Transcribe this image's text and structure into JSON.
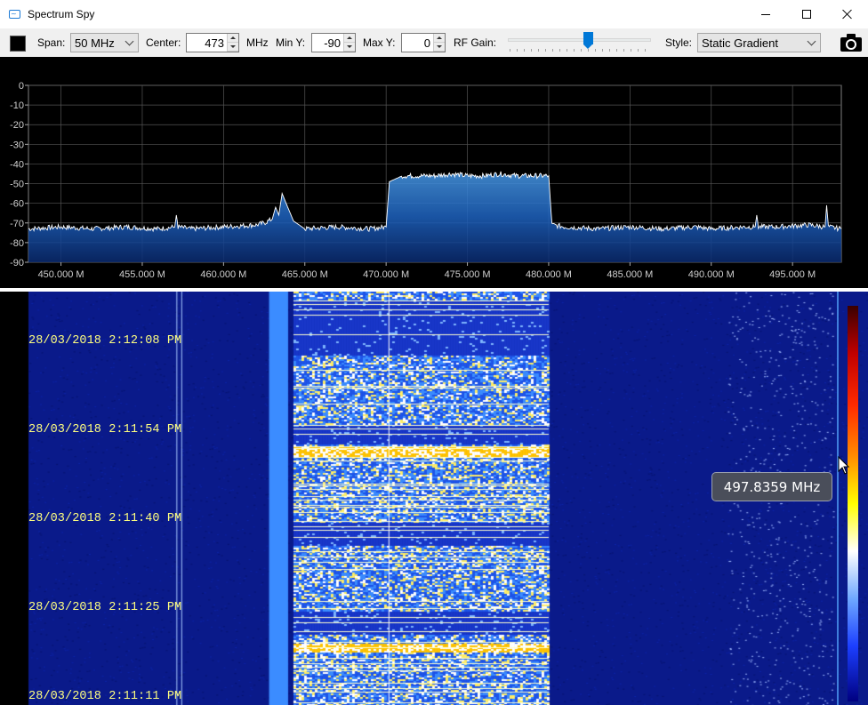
{
  "window": {
    "title": "Spectrum Spy",
    "icon": "spectrum-app-icon"
  },
  "toolbar": {
    "span_label": "Span:",
    "span_value": "50 MHz",
    "center_label": "Center:",
    "center_value": "473",
    "center_unit": "MHz",
    "min_y_label": "Min Y:",
    "min_y_value": "-90",
    "max_y_label": "Max Y:",
    "max_y_value": "0",
    "rf_gain_label": "RF Gain:",
    "rf_gain_level": 0.56,
    "style_label": "Style:",
    "style_value": "Static Gradient",
    "camera_icon": "camera-icon",
    "trace_color": "#000000"
  },
  "chart_data": {
    "type": "line",
    "title": "",
    "xlabel": "",
    "ylabel": "",
    "xlim": [
      448.0,
      498.0
    ],
    "ylim": [
      -90,
      0
    ],
    "grid": true,
    "x_ticks": [
      450,
      455,
      460,
      465,
      470,
      475,
      480,
      485,
      490,
      495
    ],
    "x_tick_labels": [
      "450.000 M",
      "455.000 M",
      "460.000 M",
      "465.000 M",
      "470.000 M",
      "475.000 M",
      "480.000 M",
      "485.000 M",
      "490.000 M",
      "495.000 M"
    ],
    "y_ticks": [
      0,
      -10,
      -20,
      -30,
      -40,
      -50,
      -60,
      -70,
      -80,
      -90
    ],
    "y_tick_labels": [
      "0",
      "-10",
      "-20",
      "-30",
      "-40",
      "-50",
      "-60",
      "-70",
      "-80",
      "-90"
    ],
    "series": [
      {
        "x": [
          448.0,
          450.0,
          452.0,
          454.0,
          456.0,
          457.0,
          457.1,
          457.2,
          458.0,
          460.0,
          462.0,
          462.5,
          463.0,
          463.2,
          463.4,
          463.6,
          464.0,
          464.3,
          465.0,
          467.0,
          469.0,
          470.0,
          470.2,
          471.0,
          472.0,
          473.0,
          474.0,
          475.0,
          476.0,
          477.0,
          478.0,
          479.0,
          480.0,
          480.2,
          481.0,
          483.0,
          485.0,
          487.0,
          489.0,
          490.0,
          492.0,
          492.7,
          492.8,
          492.9,
          494.0,
          496.0,
          497.0,
          497.1,
          497.2,
          498.0
        ],
        "y": [
          -73,
          -72,
          -73,
          -72,
          -73,
          -72,
          -66,
          -72,
          -73,
          -72,
          -71,
          -70,
          -68,
          -62,
          -66,
          -55,
          -63,
          -69,
          -73,
          -72,
          -73,
          -72,
          -49,
          -46,
          -46,
          -46,
          -45,
          -46,
          -46,
          -45,
          -46,
          -46,
          -46,
          -71,
          -72,
          -73,
          -72,
          -73,
          -72,
          -73,
          -72,
          -72,
          -66,
          -72,
          -72,
          -71,
          -72,
          -61,
          -72,
          -73
        ]
      }
    ],
    "fill": "#1e63c0",
    "trace": "#ffffff"
  },
  "waterfall": {
    "timestamps": [
      "28/03/2018 2:12:08 PM",
      "28/03/2018 2:11:54 PM",
      "28/03/2018 2:11:40 PM",
      "28/03/2018 2:11:25 PM",
      "28/03/2018 2:11:11 PM"
    ],
    "tooltip": "497.8359 MHz"
  }
}
